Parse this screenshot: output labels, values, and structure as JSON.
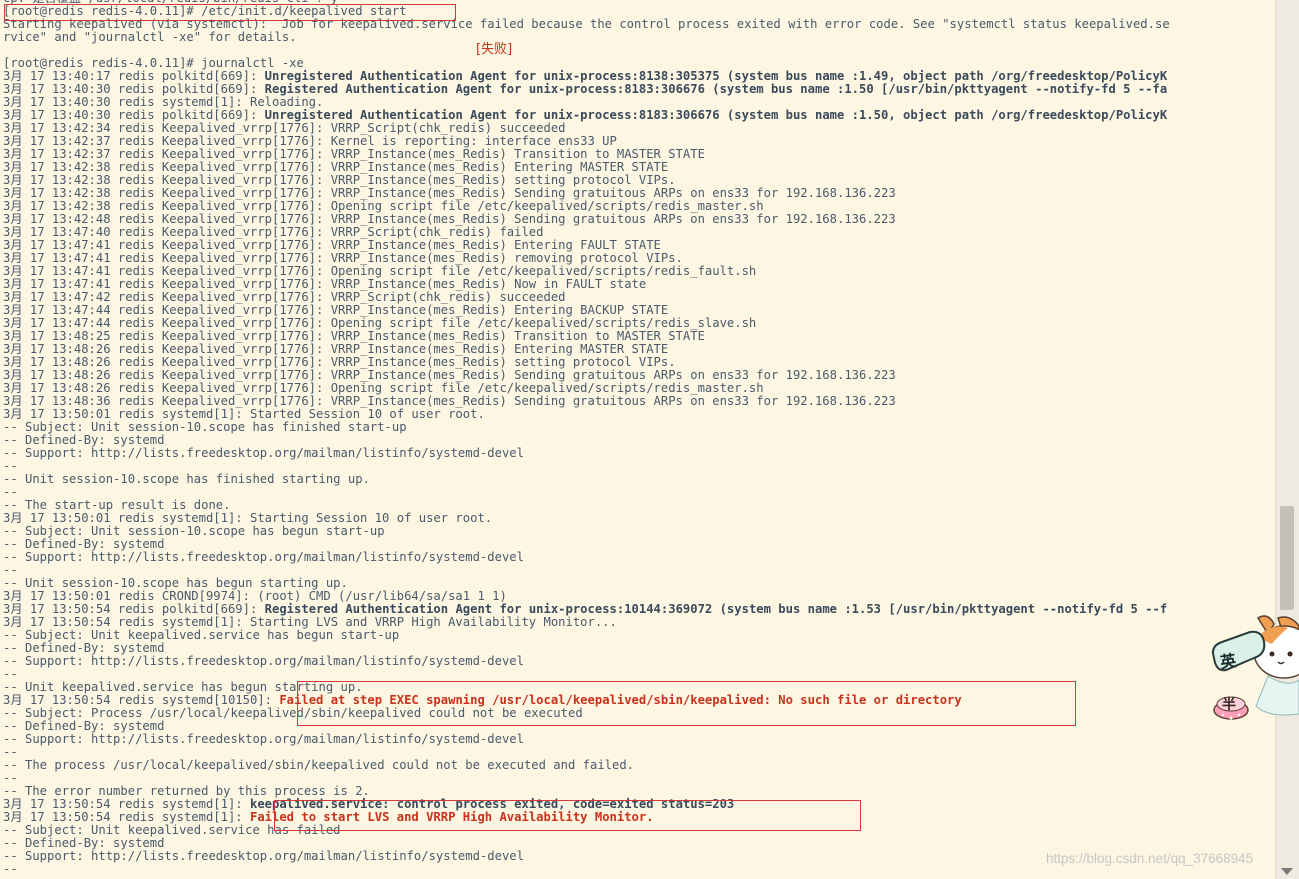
{
  "terminal": {
    "lines": [
      {
        "parts": [
          {
            "t": "cp: 是否覆盖 /usr/local/redis/bin/redis-cli ? y"
          }
        ]
      },
      {
        "parts": [
          {
            "t": "[root@redis redis-4.0.11]# /etc/init.d/keepalived start"
          }
        ]
      },
      {
        "parts": [
          {
            "t": "Starting keepalived (via systemctl):  Job for keepalived.service failed because the control process exited with error code. See \"systemctl status keepalived.se"
          }
        ]
      },
      {
        "parts": [
          {
            "t": "rvice\" and \"journalctl -xe\" for details."
          }
        ]
      },
      {
        "parts": [
          {
            "t": ""
          }
        ]
      },
      {
        "parts": [
          {
            "t": "[root@redis redis-4.0.11]# journalctl -xe"
          }
        ]
      },
      {
        "parts": [
          {
            "t": "3月 17 13:40:17 redis polkitd[669]: "
          },
          {
            "t": "Unregistered Authentication Agent for unix-process:8138:305375 (system bus name :1.49, object path /org/freedesktop/PolicyK",
            "s": "b"
          }
        ]
      },
      {
        "parts": [
          {
            "t": "3月 17 13:40:30 redis polkitd[669]: "
          },
          {
            "t": "Registered Authentication Agent for unix-process:8183:306676 (system bus name :1.50 [/usr/bin/pkttyagent --notify-fd 5 --fa",
            "s": "b"
          }
        ]
      },
      {
        "parts": [
          {
            "t": "3月 17 13:40:30 redis systemd[1]: Reloading."
          }
        ]
      },
      {
        "parts": [
          {
            "t": "3月 17 13:40:30 redis polkitd[669]: "
          },
          {
            "t": "Unregistered Authentication Agent for unix-process:8183:306676 (system bus name :1.50, object path /org/freedesktop/PolicyK",
            "s": "b"
          }
        ]
      },
      {
        "parts": [
          {
            "t": "3月 17 13:42:34 redis Keepalived_vrrp[1776]: VRRP_Script(chk_redis) succeeded"
          }
        ]
      },
      {
        "parts": [
          {
            "t": "3月 17 13:42:37 redis Keepalived_vrrp[1776]: Kernel is reporting: interface ens33 UP"
          }
        ]
      },
      {
        "parts": [
          {
            "t": "3月 17 13:42:37 redis Keepalived_vrrp[1776]: VRRP_Instance(mes_Redis) Transition to MASTER STATE"
          }
        ]
      },
      {
        "parts": [
          {
            "t": "3月 17 13:42:38 redis Keepalived_vrrp[1776]: VRRP_Instance(mes_Redis) Entering MASTER STATE"
          }
        ]
      },
      {
        "parts": [
          {
            "t": "3月 17 13:42:38 redis Keepalived_vrrp[1776]: VRRP_Instance(mes_Redis) setting protocol VIPs."
          }
        ]
      },
      {
        "parts": [
          {
            "t": "3月 17 13:42:38 redis Keepalived_vrrp[1776]: VRRP_Instance(mes_Redis) Sending gratuitous ARPs on ens33 for 192.168.136.223"
          }
        ]
      },
      {
        "parts": [
          {
            "t": "3月 17 13:42:38 redis Keepalived_vrrp[1776]: Opening script file /etc/keepalived/scripts/redis_master.sh"
          }
        ]
      },
      {
        "parts": [
          {
            "t": "3月 17 13:42:48 redis Keepalived_vrrp[1776]: VRRP_Instance(mes_Redis) Sending gratuitous ARPs on ens33 for 192.168.136.223"
          }
        ]
      },
      {
        "parts": [
          {
            "t": "3月 17 13:47:40 redis Keepalived_vrrp[1776]: VRRP_Script(chk_redis) failed"
          }
        ]
      },
      {
        "parts": [
          {
            "t": "3月 17 13:47:41 redis Keepalived_vrrp[1776]: VRRP_Instance(mes_Redis) Entering FAULT STATE"
          }
        ]
      },
      {
        "parts": [
          {
            "t": "3月 17 13:47:41 redis Keepalived_vrrp[1776]: VRRP_Instance(mes_Redis) removing protocol VIPs."
          }
        ]
      },
      {
        "parts": [
          {
            "t": "3月 17 13:47:41 redis Keepalived_vrrp[1776]: Opening script file /etc/keepalived/scripts/redis_fault.sh"
          }
        ]
      },
      {
        "parts": [
          {
            "t": "3月 17 13:47:41 redis Keepalived_vrrp[1776]: VRRP_Instance(mes_Redis) Now in FAULT state"
          }
        ]
      },
      {
        "parts": [
          {
            "t": "3月 17 13:47:42 redis Keepalived_vrrp[1776]: VRRP_Script(chk_redis) succeeded"
          }
        ]
      },
      {
        "parts": [
          {
            "t": "3月 17 13:47:44 redis Keepalived_vrrp[1776]: VRRP_Instance(mes_Redis) Entering BACKUP STATE"
          }
        ]
      },
      {
        "parts": [
          {
            "t": "3月 17 13:47:44 redis Keepalived_vrrp[1776]: Opening script file /etc/keepalived/scripts/redis_slave.sh"
          }
        ]
      },
      {
        "parts": [
          {
            "t": "3月 17 13:48:25 redis Keepalived_vrrp[1776]: VRRP_Instance(mes_Redis) Transition to MASTER STATE"
          }
        ]
      },
      {
        "parts": [
          {
            "t": "3月 17 13:48:26 redis Keepalived_vrrp[1776]: VRRP_Instance(mes_Redis) Entering MASTER STATE"
          }
        ]
      },
      {
        "parts": [
          {
            "t": "3月 17 13:48:26 redis Keepalived_vrrp[1776]: VRRP_Instance(mes_Redis) setting protocol VIPs."
          }
        ]
      },
      {
        "parts": [
          {
            "t": "3月 17 13:48:26 redis Keepalived_vrrp[1776]: VRRP_Instance(mes_Redis) Sending gratuitous ARPs on ens33 for 192.168.136.223"
          }
        ]
      },
      {
        "parts": [
          {
            "t": "3月 17 13:48:26 redis Keepalived_vrrp[1776]: Opening script file /etc/keepalived/scripts/redis_master.sh"
          }
        ]
      },
      {
        "parts": [
          {
            "t": "3月 17 13:48:36 redis Keepalived_vrrp[1776]: VRRP_Instance(mes_Redis) Sending gratuitous ARPs on ens33 for 192.168.136.223"
          }
        ]
      },
      {
        "parts": [
          {
            "t": "3月 17 13:50:01 redis systemd[1]: Started Session 10 of user root."
          }
        ]
      },
      {
        "parts": [
          {
            "t": "-- Subject: Unit session-10.scope has finished start-up"
          }
        ]
      },
      {
        "parts": [
          {
            "t": "-- Defined-By: systemd"
          }
        ]
      },
      {
        "parts": [
          {
            "t": "-- Support: http://lists.freedesktop.org/mailman/listinfo/systemd-devel"
          }
        ]
      },
      {
        "parts": [
          {
            "t": "--"
          }
        ]
      },
      {
        "parts": [
          {
            "t": "-- Unit session-10.scope has finished starting up."
          }
        ]
      },
      {
        "parts": [
          {
            "t": "--"
          }
        ]
      },
      {
        "parts": [
          {
            "t": "-- The start-up result is done."
          }
        ]
      },
      {
        "parts": [
          {
            "t": "3月 17 13:50:01 redis systemd[1]: Starting Session 10 of user root."
          }
        ]
      },
      {
        "parts": [
          {
            "t": "-- Subject: Unit session-10.scope has begun start-up"
          }
        ]
      },
      {
        "parts": [
          {
            "t": "-- Defined-By: systemd"
          }
        ]
      },
      {
        "parts": [
          {
            "t": "-- Support: http://lists.freedesktop.org/mailman/listinfo/systemd-devel"
          }
        ]
      },
      {
        "parts": [
          {
            "t": "--"
          }
        ]
      },
      {
        "parts": [
          {
            "t": "-- Unit session-10.scope has begun starting up."
          }
        ]
      },
      {
        "parts": [
          {
            "t": "3月 17 13:50:01 redis CROND[9974]: (root) CMD (/usr/lib64/sa/sa1 1 1)"
          }
        ]
      },
      {
        "parts": [
          {
            "t": "3月 17 13:50:54 redis polkitd[669]: "
          },
          {
            "t": "Registered Authentication Agent for unix-process:10144:369072 (system bus name :1.53 [/usr/bin/pkttyagent --notify-fd 5 --f",
            "s": "b"
          }
        ]
      },
      {
        "parts": [
          {
            "t": "3月 17 13:50:54 redis systemd[1]: Starting LVS and VRRP High Availability Monitor..."
          }
        ]
      },
      {
        "parts": [
          {
            "t": "-- Subject: Unit keepalived.service has begun start-up"
          }
        ]
      },
      {
        "parts": [
          {
            "t": "-- Defined-By: systemd"
          }
        ]
      },
      {
        "parts": [
          {
            "t": "-- Support: http://lists.freedesktop.org/mailman/listinfo/systemd-devel"
          }
        ]
      },
      {
        "parts": [
          {
            "t": "--"
          }
        ]
      },
      {
        "parts": [
          {
            "t": "-- Unit keepalived.service has begun starting up."
          }
        ]
      },
      {
        "parts": [
          {
            "t": "3月 17 13:50:54 redis systemd[10150]: "
          },
          {
            "t": "Failed at step EXEC spawning /usr/local/keepalived/sbin/keepalived: No such file or directory",
            "s": "err"
          }
        ]
      },
      {
        "parts": [
          {
            "t": "-- Subject: Process /usr/local/keepalived/sbin/keepalived could not be executed"
          }
        ]
      },
      {
        "parts": [
          {
            "t": "-- Defined-By: systemd"
          }
        ]
      },
      {
        "parts": [
          {
            "t": "-- Support: http://lists.freedesktop.org/mailman/listinfo/systemd-devel"
          }
        ]
      },
      {
        "parts": [
          {
            "t": "--"
          }
        ]
      },
      {
        "parts": [
          {
            "t": "-- The process /usr/local/keepalived/sbin/keepalived could not be executed and failed."
          }
        ]
      },
      {
        "parts": [
          {
            "t": "--"
          }
        ]
      },
      {
        "parts": [
          {
            "t": "-- The error number returned by this process is 2."
          }
        ]
      },
      {
        "parts": [
          {
            "t": "3月 17 13:50:54 redis systemd[1]: "
          },
          {
            "t": "keepalived.service: control process exited, code=exited status=203",
            "s": "b"
          }
        ]
      },
      {
        "parts": [
          {
            "t": "3月 17 13:50:54 redis systemd[1]: "
          },
          {
            "t": "Failed to start LVS and VRRP High Availability Monitor.",
            "s": "err"
          }
        ]
      },
      {
        "parts": [
          {
            "t": "-- Subject: Unit keepalived.service has failed"
          }
        ]
      },
      {
        "parts": [
          {
            "t": "-- Defined-By: systemd"
          }
        ]
      },
      {
        "parts": [
          {
            "t": "-- Support: http://lists.freedesktop.org/mailman/listinfo/systemd-devel"
          }
        ]
      },
      {
        "parts": [
          {
            "t": "--"
          }
        ]
      }
    ]
  },
  "annotation": {
    "label": "[失败]"
  },
  "ime": {
    "lang_label": "英"
  },
  "watermark": {
    "text": "https://blog.csdn.net/qq_37668945"
  },
  "colors": {
    "background": "#fdf6e3",
    "text": "#4a5a6a",
    "error": "#c8311c",
    "highlight_box": "#d23b3b"
  }
}
